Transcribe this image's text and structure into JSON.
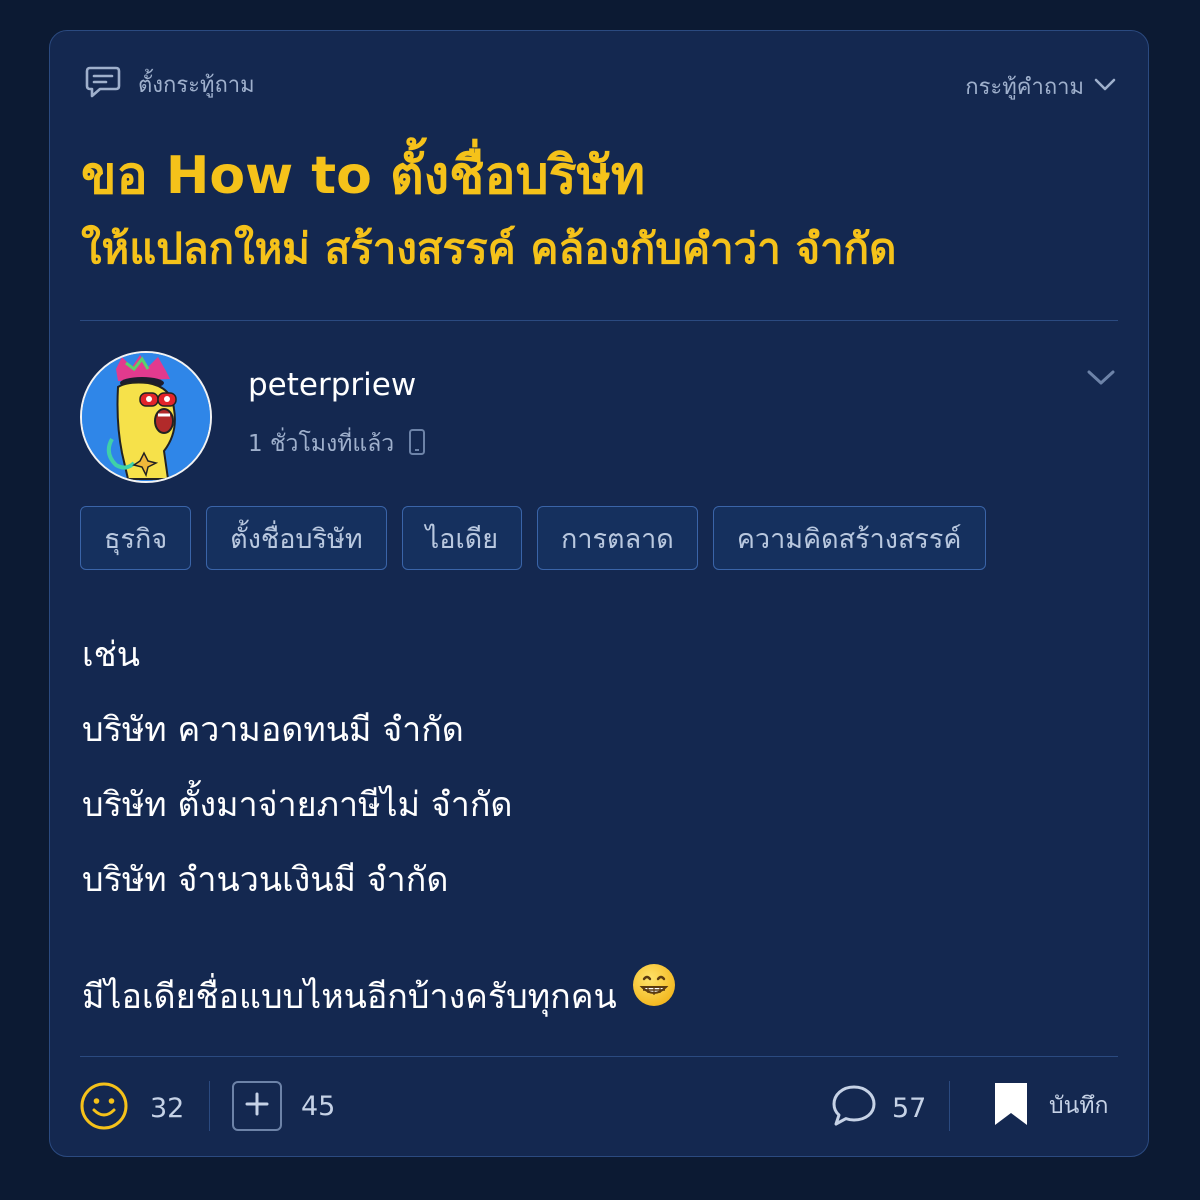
{
  "header": {
    "post_type_label": "ตั้งกระทู้ถาม",
    "sort_label": "กระทู้คำถาม"
  },
  "post": {
    "title_line1": "ขอ How to ตั้งชื่อบริษัท",
    "title_line2": "ให้แปลกใหม่ สร้างสรรค์ คล้องกับคำว่า จำกัด",
    "author": {
      "name": "peterpriew",
      "time": "1 ชั่วโมงที่แล้ว",
      "device_icon": "mobile-phone-icon"
    },
    "tags": [
      "ธุรกิจ",
      "ตั้งชื่อบริษัท",
      "ไอเดีย",
      "การตลาด",
      "ความคิดสร้างสรรค์"
    ],
    "body": {
      "line1": "เช่น",
      "line2": "บริษัท ความอดทนมี จำกัด",
      "line3": "บริษัท ตั้งมาจ่ายภาษีไม่ จำกัด",
      "line4": "บริษัท จำนวนเงินมี จำกัด",
      "closing": "มีไอเดียชื่อแบบไหนอีกบ้างครับทุกคน",
      "closing_emoji": "grinning-face-icon"
    }
  },
  "actions": {
    "emotion_count": "32",
    "vote_count": "45",
    "comment_count": "57",
    "save_label": "บันทึก"
  },
  "colors": {
    "background": "#0c1a33",
    "card": "#142850",
    "accent_title": "#f5c21a",
    "muted_text": "#9fb0cc",
    "tag_border": "#3a64a8"
  }
}
